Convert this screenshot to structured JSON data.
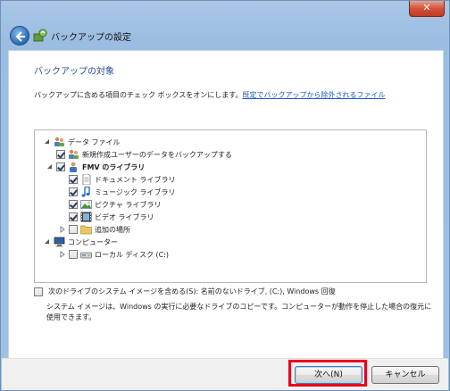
{
  "window": {
    "title": "バックアップの設定",
    "close_label": "✕"
  },
  "page": {
    "heading": "バックアップの対象",
    "description": "バックアップに含める項目のチェック ボックスをオンにします。",
    "description_link": "既定でバックアップから除外されるファイル"
  },
  "tree": {
    "data_files": "データ ファイル",
    "new_users": "新規作成ユーザーのデータをバックアップする",
    "fmv_library": "FMV のライブラリ",
    "documents": "ドキュメント ライブラリ",
    "music": "ミュージック ライブラリ",
    "pictures": "ピクチャ ライブラリ",
    "video": "ビデオ ライブラリ",
    "additional": "追加の場所",
    "computer": "コンピューター",
    "local_disk": "ローカル ディスク (C:)"
  },
  "system_image": {
    "label": "次のドライブのシステム イメージを含める(S): 名前のないドライブ, (C:), Windows 回復",
    "note": "システム イメージは、Windows の実行に必要なドライブのコピーです。コンピューターが動作を停止した場合の復元に使用できます。"
  },
  "buttons": {
    "next": "次へ(N)",
    "cancel": "キャンセル"
  },
  "colors": {
    "heading": "#1f4c8f",
    "link": "#1a58c8",
    "highlight": "#e8001c"
  }
}
